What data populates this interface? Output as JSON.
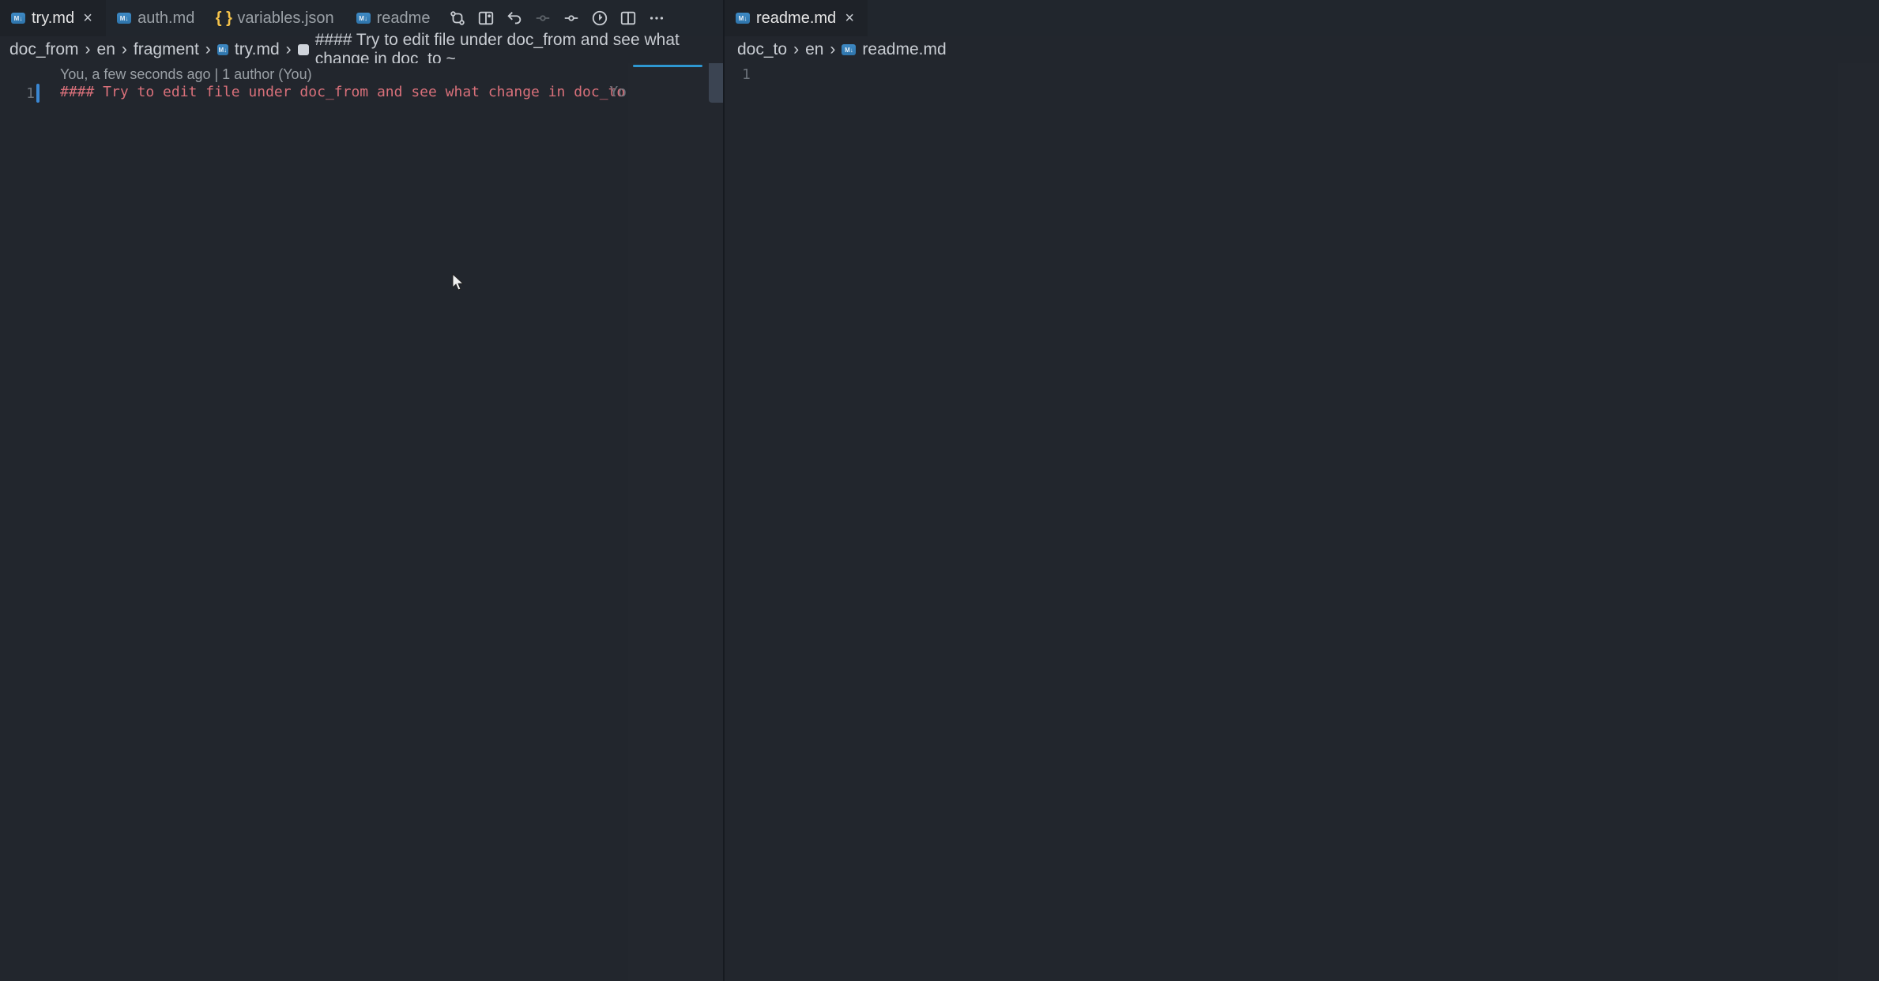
{
  "left": {
    "tabs": [
      {
        "label": "try.md",
        "icon": "md",
        "active": true,
        "closable": true
      },
      {
        "label": "auth.md",
        "icon": "md",
        "active": false,
        "closable": false
      },
      {
        "label": "variables.json",
        "icon": "json",
        "active": false,
        "closable": false
      },
      {
        "label": "readme",
        "icon": "md",
        "active": false,
        "closable": false
      }
    ],
    "breadcrumb": {
      "p1": "doc_from",
      "p2": "en",
      "p3": "fragment",
      "file": "try.md",
      "symbol": "#### Try to edit file under doc_from and see what change in doc_to ~"
    },
    "blame": "You, a few seconds ago | 1 author (You)",
    "lineNumber": "1",
    "code": "#### Try to edit file under doc_from and see what change in doc_to ~",
    "inlineHint": "Yo"
  },
  "right": {
    "tabs": [
      {
        "label": "readme.md",
        "icon": "md",
        "active": true,
        "closable": true
      }
    ],
    "breadcrumb": {
      "p1": "doc_to",
      "p2": "en",
      "file": "readme.md"
    },
    "lineNumber": "1"
  },
  "icons": {
    "close": "×",
    "chev": "›"
  }
}
